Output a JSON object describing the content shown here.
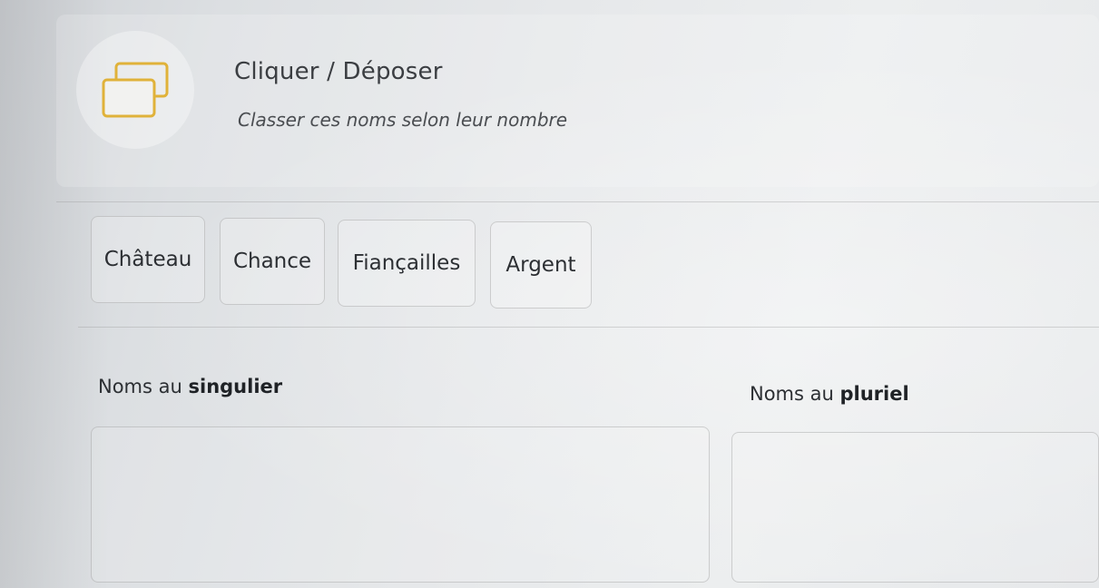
{
  "activity": {
    "type_label": "Cliquer / Déposer",
    "instruction": "Classer ces noms selon leur nombre",
    "icon": "drag-drop-windows-icon",
    "icon_color": "#e0b23a"
  },
  "word_bank": {
    "words": [
      "Château",
      "Chance",
      "Fiançailles",
      "Argent"
    ]
  },
  "zones": [
    {
      "label_prefix": "Noms au",
      "label_bold": "singulier"
    },
    {
      "label_prefix": "Noms au",
      "label_bold": "pluriel"
    }
  ]
}
